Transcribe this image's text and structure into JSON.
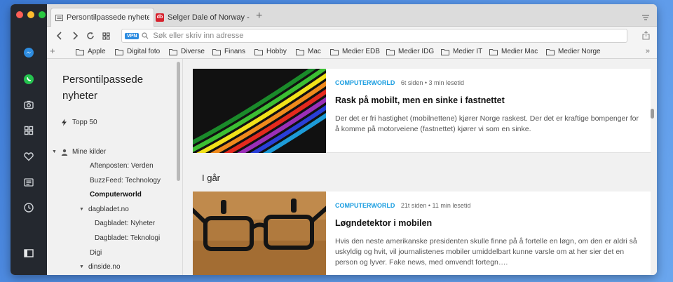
{
  "tabs": [
    {
      "title": "Persontilpassede nyheter - C",
      "active": true,
      "favicon": "news-icon"
    },
    {
      "title": "Selger Dale of Norway - Dagb",
      "active": false,
      "favicon": "db-logo",
      "favicon_text": "db"
    }
  ],
  "address": {
    "vpn_label": "VPN",
    "placeholder": "Søk eller skriv inn adresse"
  },
  "bookmarks": [
    "Apple",
    "Digital foto",
    "Diverse",
    "Finans",
    "Hobby",
    "Mac",
    "Medier EDB",
    "Medier IDG",
    "Medier IT",
    "Medier Mac",
    "Medier Norge"
  ],
  "sidebar": {
    "title": "Persontilpassede nyheter",
    "top50": "Topp 50",
    "my_sources": "Mine kilder",
    "sources": [
      {
        "label": "Aftenposten: Verden"
      },
      {
        "label": "BuzzFeed: Technology"
      },
      {
        "label": "Computerworld"
      },
      {
        "label": "dagbladet.no"
      },
      {
        "label": "Dagbladet: Nyheter"
      },
      {
        "label": "Dagbladet: Teknologi"
      },
      {
        "label": "Digi"
      },
      {
        "label": "dinside.no"
      }
    ]
  },
  "feed": {
    "day_label": "I går",
    "articles": [
      {
        "source": "COMPUTERWORLD",
        "meta": "6t siden • 3 min lesetid",
        "headline": "Rask på mobilt, men en sinke i fastnettet",
        "description": "Der det er fri hastighet (mobilnettene) kjører Norge raskest. Der det er kraftige bompenger for å komme på motorveiene (fastnettet) kjører vi som en sinke."
      },
      {
        "source": "COMPUTERWORLD",
        "meta": "21t siden • 11 min lesetid",
        "headline": "Løgndetektor i mobilen",
        "description": "Hvis den neste amerikanske presidenten skulle finne på å fortelle en løgn, om den er aldri så uskyldig og hvit, vil journalistenes mobiler umiddelbart kunne varsle om at her sier det en person og lyver. Fake news, med omvendt fortegn…."
      }
    ]
  },
  "colors": {
    "accent": "#1a9de0",
    "sidebar_dark": "#24282f",
    "vpn": "#2d8ce0"
  }
}
